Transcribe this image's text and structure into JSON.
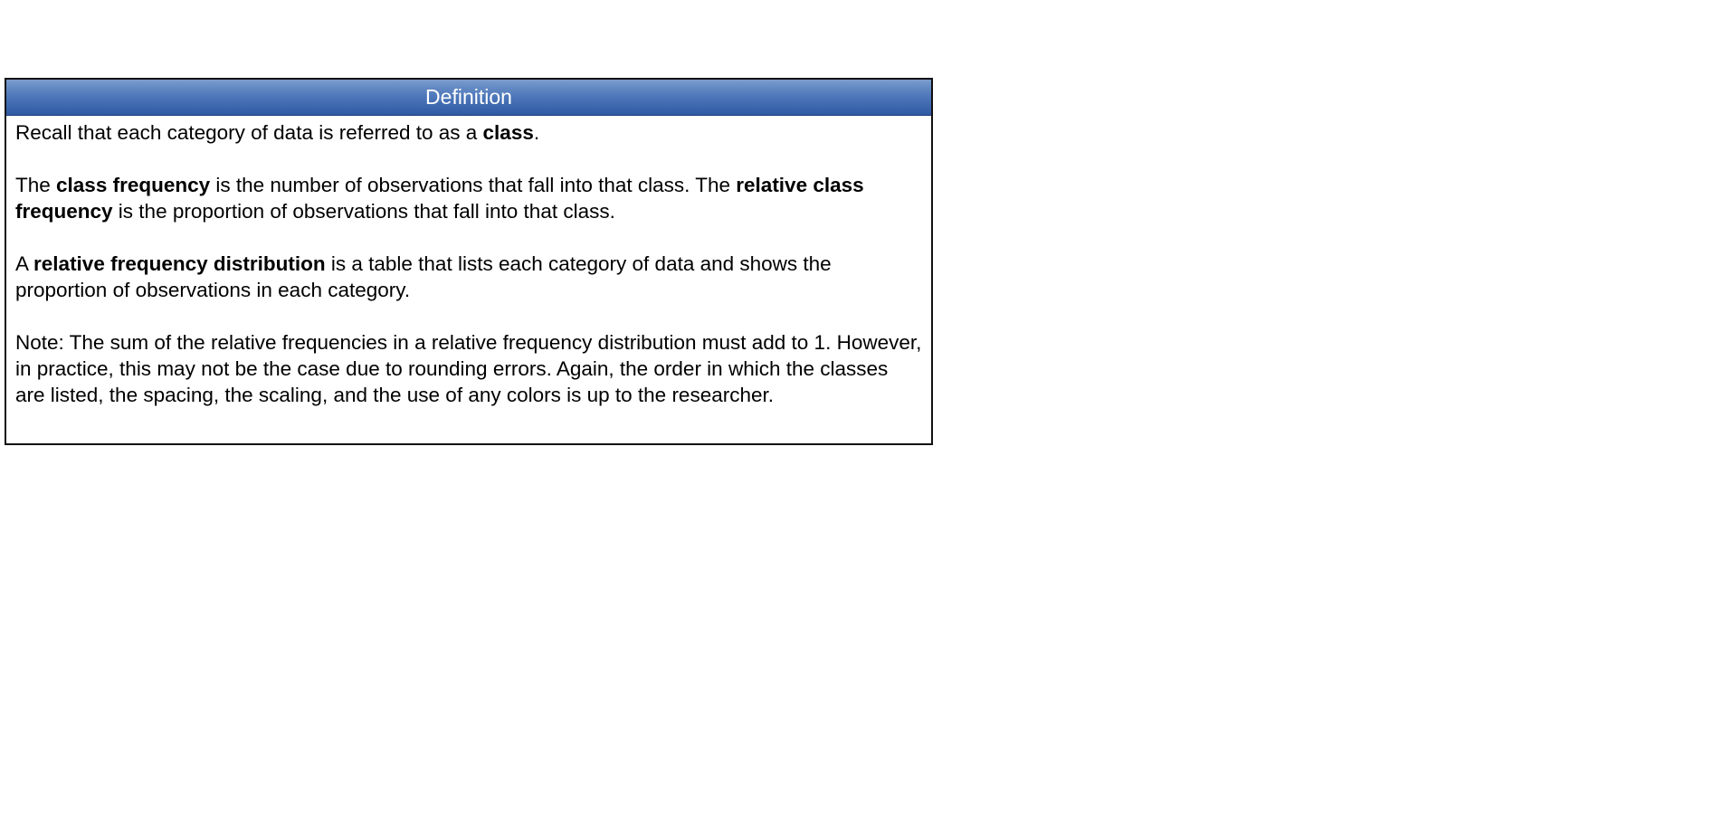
{
  "definition": {
    "title": "Definition",
    "p1": {
      "t1": "Recall that each category of data is referred to as a ",
      "b1": "class",
      "t2": "."
    },
    "p2": {
      "t1": "The ",
      "b1": "class frequency",
      "t2": " is the number of observations that fall into that class.  The ",
      "b2": "relative class frequency",
      "t3": " is the proportion of observations that fall into that class."
    },
    "p3": {
      "t1": "A ",
      "b1": "relative frequency distribution",
      "t2": " is a table that lists each category of data and shows the proportion of observations in each category."
    },
    "p4": {
      "t1": "Note:  The sum of the relative frequencies in a relative frequency distribution must add to 1.  However, in practice, this may not be the case due to rounding errors.  Again, the order in which the classes are listed, the spacing, the scaling, and the use of any colors is up to the researcher."
    }
  }
}
